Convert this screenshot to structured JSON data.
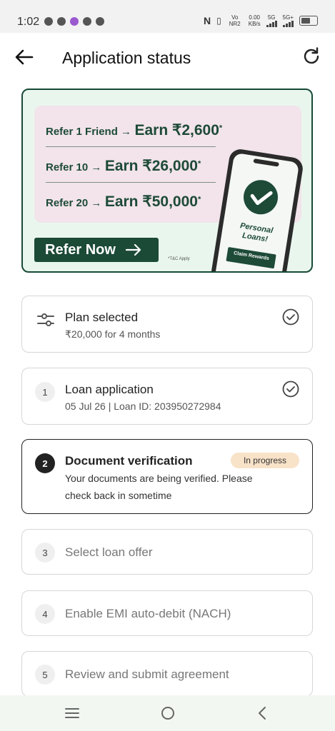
{
  "status_bar": {
    "time": "1:02",
    "network": "Vo NR2",
    "speed_value": "0.00",
    "speed_unit": "KB/s",
    "sim1": "5G",
    "sim2": "5G+"
  },
  "header": {
    "title": "Application status"
  },
  "banner": {
    "lines": [
      {
        "small": "Refer 1 Friend →",
        "big": "Earn ₹2,600",
        "mark": "*"
      },
      {
        "small": "Refer 10 →",
        "big": "Earn ₹26,000",
        "mark": "*"
      },
      {
        "small": "Refer 20 →",
        "big": "Earn ₹50,000",
        "mark": "*"
      }
    ],
    "button_label": "Refer Now",
    "tc": "*T&C Apply",
    "phone_text_1": "Personal",
    "phone_text_2": "Loans!",
    "phone_button": "Claim Rewards"
  },
  "steps": [
    {
      "title": "Plan selected",
      "subtitle": "₹20,000 for 4 months",
      "icon": "sliders-icon",
      "status": "done"
    },
    {
      "number": "1",
      "title": "Loan application",
      "subtitle": "05 Jul 26 | Loan ID: 203950272984",
      "status": "done"
    },
    {
      "number": "2",
      "title": "Document verification",
      "badge": "In progress",
      "subtitle_1": "Your documents are being verified. Please",
      "subtitle_2": "check back in sometime",
      "status": "active"
    },
    {
      "number": "3",
      "title": "Select loan offer",
      "status": "pending"
    },
    {
      "number": "4",
      "title": "Enable EMI auto-debit (NACH)",
      "status": "pending"
    },
    {
      "number": "5",
      "title": "Review and submit agreement",
      "status": "pending"
    }
  ],
  "colors": {
    "brand": "#1b4a37",
    "badge": "#f8e2c8",
    "banner_bg": "#e9f6ee",
    "banner_panel": "#f2e4ea"
  }
}
